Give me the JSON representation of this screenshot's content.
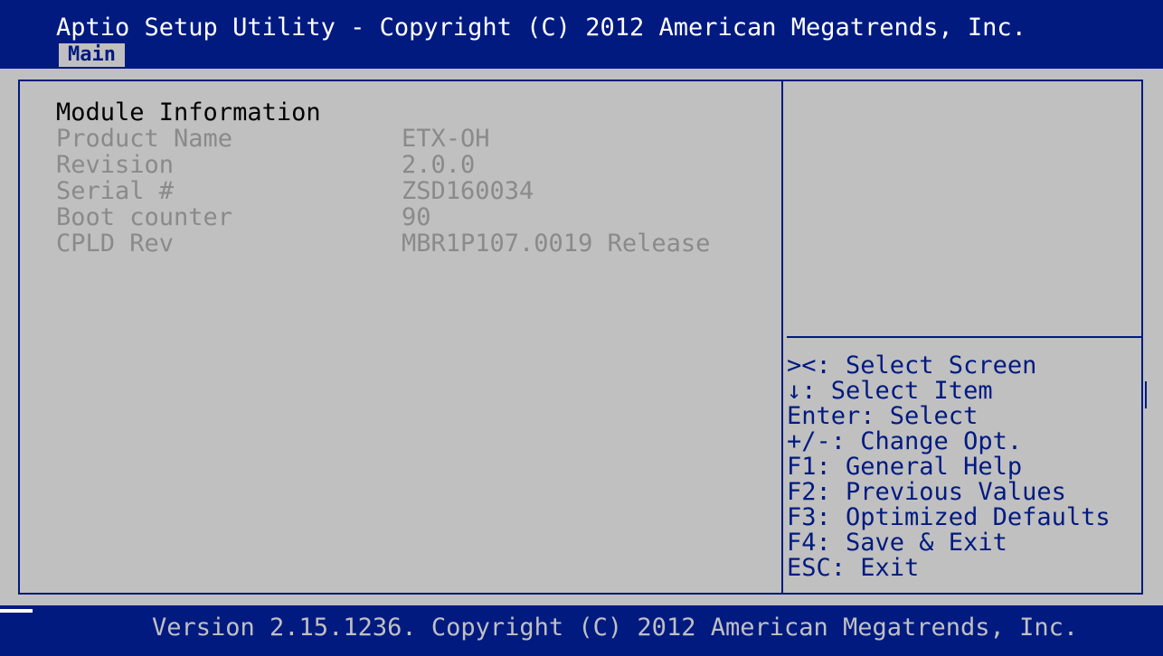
{
  "window": {
    "title": "Aptio Setup Utility - Copyright (C) 2012 American Megatrends, Inc."
  },
  "tabs": [
    {
      "label": "Main",
      "active": true
    }
  ],
  "module": {
    "title": "Module Information",
    "rows": [
      {
        "label": "Product Name",
        "value": "ETX-OH"
      },
      {
        "label": "Revision",
        "value": "2.0.0"
      },
      {
        "label": "Serial #",
        "value": "ZSD160034"
      },
      {
        "label": "Boot counter",
        "value": "90"
      },
      {
        "label": "CPLD Rev",
        "value": "MBR1P107.0019 Release"
      }
    ]
  },
  "help": [
    "><: Select Screen",
    "↓: Select Item",
    "Enter: Select",
    "+/-: Change Opt.",
    "F1: General Help",
    "F2: Previous Values",
    "F3: Optimized Defaults",
    "F4: Save & Exit",
    "ESC: Exit"
  ],
  "footer": {
    "text": "Version 2.15.1236. Copyright (C) 2012 American Megatrends, Inc."
  },
  "colors": {
    "header_bg": "#001a80",
    "panel_bg": "#c0c0c0",
    "disabled_text": "#8a8a8a",
    "help_text": "#001a80"
  }
}
